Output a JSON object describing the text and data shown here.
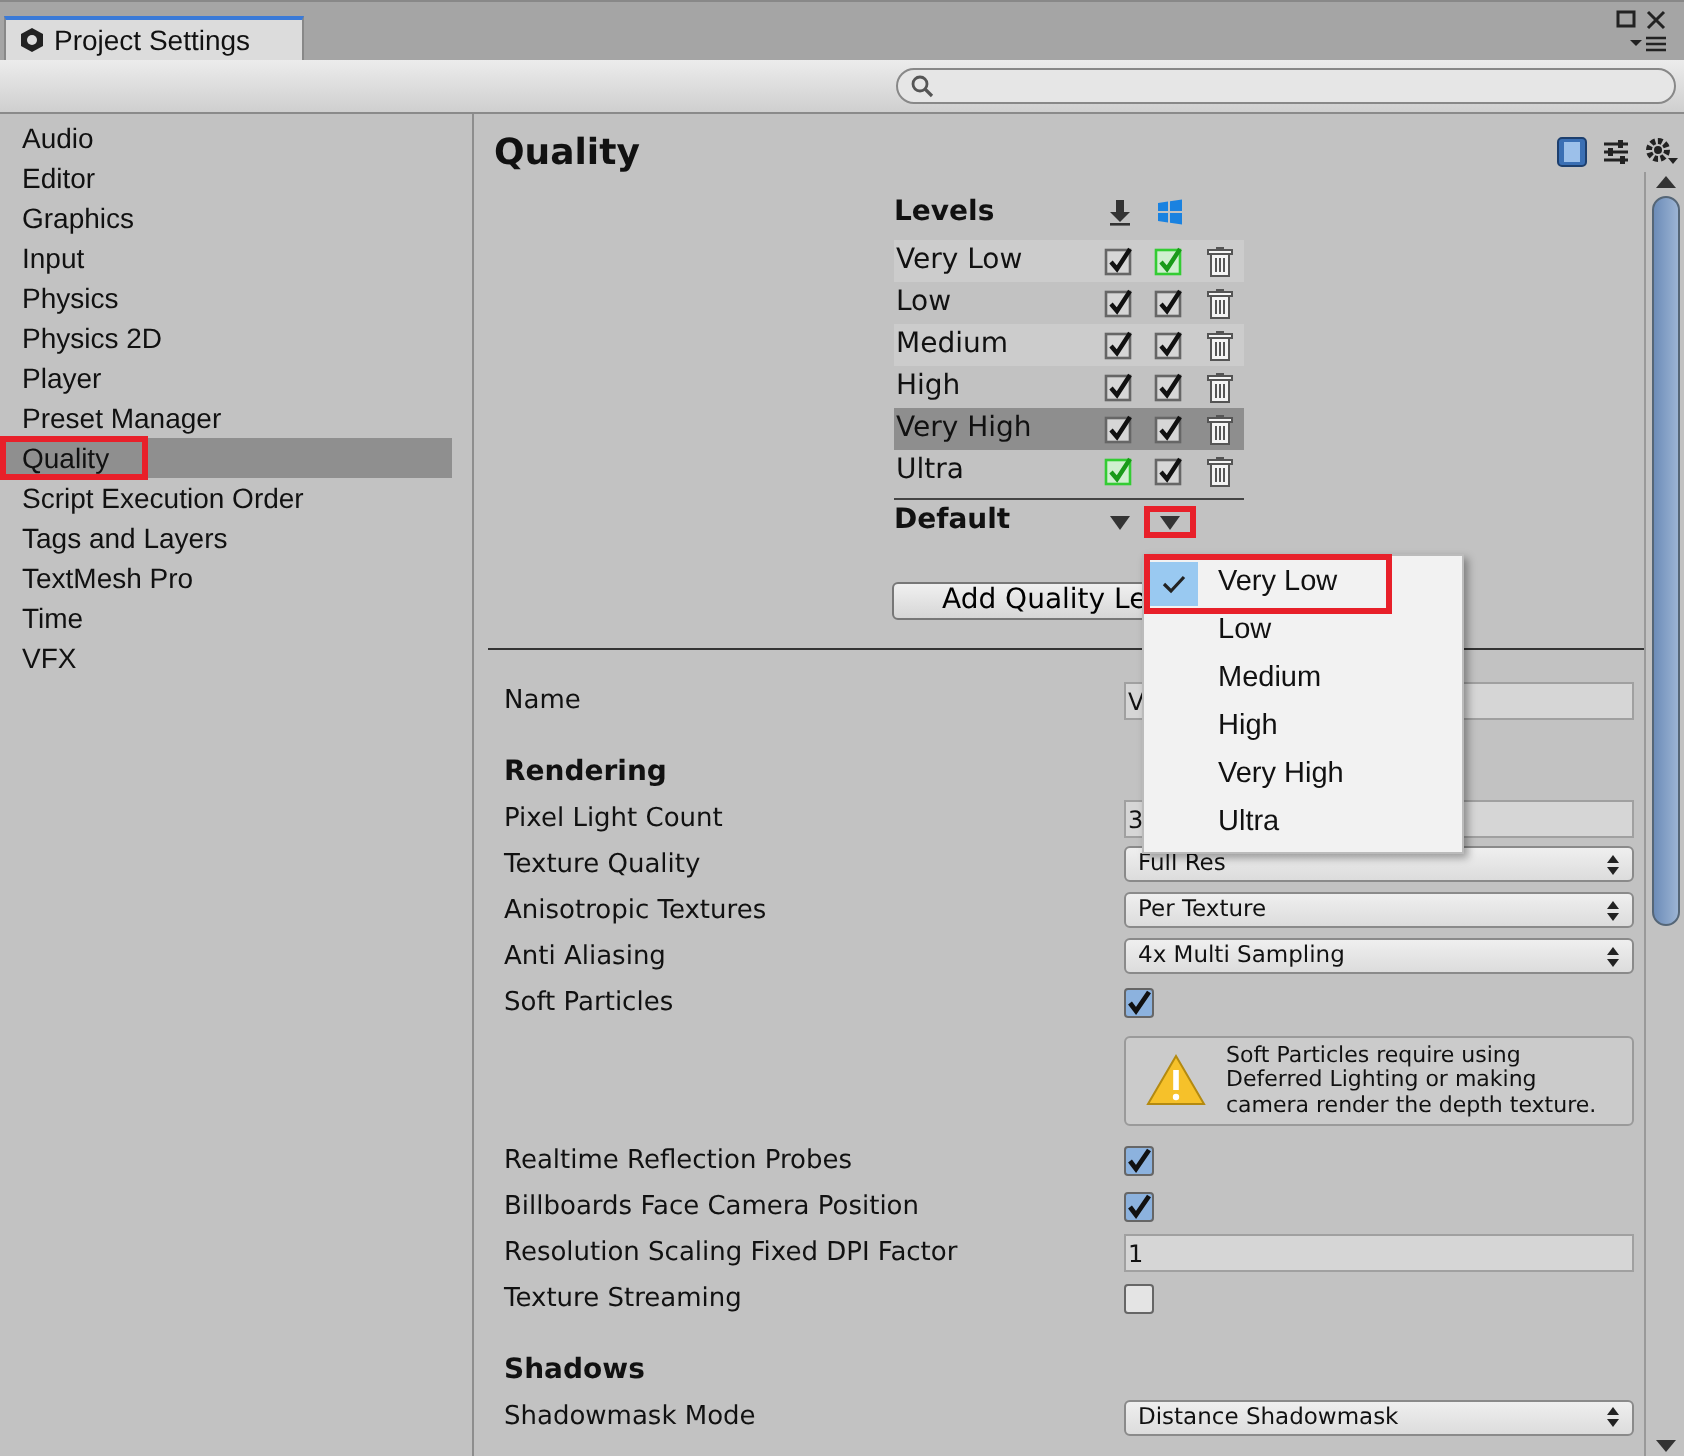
{
  "window": {
    "tab_title": "Project Settings"
  },
  "sidebar": {
    "items": [
      {
        "label": "Audio",
        "selected": false,
        "highlighted": false
      },
      {
        "label": "Editor",
        "selected": false,
        "highlighted": false
      },
      {
        "label": "Graphics",
        "selected": false,
        "highlighted": false
      },
      {
        "label": "Input",
        "selected": false,
        "highlighted": false
      },
      {
        "label": "Physics",
        "selected": false,
        "highlighted": false
      },
      {
        "label": "Physics 2D",
        "selected": false,
        "highlighted": false
      },
      {
        "label": "Player",
        "selected": false,
        "highlighted": false
      },
      {
        "label": "Preset Manager",
        "selected": false,
        "highlighted": false
      },
      {
        "label": "Quality",
        "selected": true,
        "highlighted": true
      },
      {
        "label": "Script Execution Order",
        "selected": false,
        "highlighted": false
      },
      {
        "label": "Tags and Layers",
        "selected": false,
        "highlighted": false
      },
      {
        "label": "TextMesh Pro",
        "selected": false,
        "highlighted": false
      },
      {
        "label": "Time",
        "selected": false,
        "highlighted": false
      },
      {
        "label": "VFX",
        "selected": false,
        "highlighted": false
      }
    ]
  },
  "panel": {
    "title": "Quality"
  },
  "levels": {
    "heading": "Levels",
    "rows": [
      {
        "name": "Very Low",
        "selected": false,
        "checks": [
          {
            "checked": true,
            "default": false
          },
          {
            "checked": true,
            "default": true
          }
        ]
      },
      {
        "name": "Low",
        "selected": false,
        "checks": [
          {
            "checked": true,
            "default": false
          },
          {
            "checked": true,
            "default": false
          }
        ]
      },
      {
        "name": "Medium",
        "selected": false,
        "checks": [
          {
            "checked": true,
            "default": false
          },
          {
            "checked": true,
            "default": false
          }
        ]
      },
      {
        "name": "High",
        "selected": false,
        "checks": [
          {
            "checked": true,
            "default": false
          },
          {
            "checked": true,
            "default": false
          }
        ]
      },
      {
        "name": "Very High",
        "selected": true,
        "checks": [
          {
            "checked": true,
            "default": false
          },
          {
            "checked": true,
            "default": false
          }
        ]
      },
      {
        "name": "Ultra",
        "selected": false,
        "checks": [
          {
            "checked": true,
            "default": true
          },
          {
            "checked": true,
            "default": false
          }
        ]
      }
    ],
    "default_label": "Default",
    "default_pickers": [
      {
        "highlighted": false
      },
      {
        "highlighted": true
      }
    ],
    "add_button": "Add Quality Le"
  },
  "properties": [
    {
      "kind": "text",
      "label": "Name",
      "value": "V"
    },
    {
      "kind": "heading",
      "label": "Rendering"
    },
    {
      "kind": "text",
      "label": "Pixel Light Count",
      "value": "3"
    },
    {
      "kind": "select",
      "label": "Texture Quality",
      "value": "Full Res"
    },
    {
      "kind": "select",
      "label": "Anisotropic Textures",
      "value": "Per Texture"
    },
    {
      "kind": "select",
      "label": "Anti Aliasing",
      "value": "4x Multi Sampling"
    },
    {
      "kind": "checkbox",
      "label": "Soft Particles",
      "checked": true
    },
    {
      "kind": "help",
      "text": "Soft Particles require using Deferred Lighting or making camera render the depth texture."
    },
    {
      "kind": "checkbox",
      "label": "Realtime Reflection Probes",
      "checked": true
    },
    {
      "kind": "checkbox",
      "label": "Billboards Face Camera Position",
      "checked": true
    },
    {
      "kind": "text",
      "label": "Resolution Scaling Fixed DPI Factor",
      "value": "1"
    },
    {
      "kind": "checkbox",
      "label": "Texture Streaming",
      "checked": false
    },
    {
      "kind": "heading",
      "label": "Shadows"
    },
    {
      "kind": "select",
      "label": "Shadowmask Mode",
      "value": "Distance Shadowmask"
    }
  ],
  "dropdown_menu": {
    "items": [
      {
        "label": "Very Low",
        "selected": true,
        "highlighted": true
      },
      {
        "label": "Low",
        "selected": false,
        "highlighted": false
      },
      {
        "label": "Medium",
        "selected": false,
        "highlighted": false
      },
      {
        "label": "High",
        "selected": false,
        "highlighted": false
      },
      {
        "label": "Very High",
        "selected": false,
        "highlighted": false
      },
      {
        "label": "Ultra",
        "selected": false,
        "highlighted": false
      }
    ]
  }
}
